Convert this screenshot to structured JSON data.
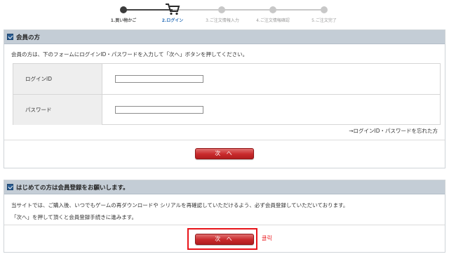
{
  "steps": [
    {
      "label": "1.買い物かご",
      "state": "done"
    },
    {
      "label": "2.ログイン",
      "state": "current"
    },
    {
      "label": "3.ご注文情報入力",
      "state": "todo"
    },
    {
      "label": "4.ご注文情報確認",
      "state": "todo"
    },
    {
      "label": "5.ご注文完了",
      "state": "todo"
    }
  ],
  "member": {
    "title": "会員の方",
    "intro": "会員の方は、下のフォームにログインID・パスワードを入力して「次へ」ボタンを押してください。",
    "login_id_label": "ログインID",
    "login_id_value": "",
    "password_label": "パスワード",
    "password_value": "",
    "forgot_link": "→ログインID・パスワードを忘れた方",
    "next_button": "次 へ"
  },
  "new_user": {
    "title": "はじめての方は会員登録をお願いします。",
    "text1": "当サイトでは、ご購入後、いつでもゲームの再ダウンロードや シリアルを再確認していただけるよう、必ず会員登録していただいております。",
    "text2": "「次へ」を押して頂くと会員登録手続きに進みます。",
    "next_button": "次 へ",
    "annotation": "클릭",
    "annotation_color": "#e8141a"
  },
  "colors": {
    "header_bg": "#c4cdd6",
    "button_red": "#c8292b",
    "current_step": "#2a6fb8"
  }
}
